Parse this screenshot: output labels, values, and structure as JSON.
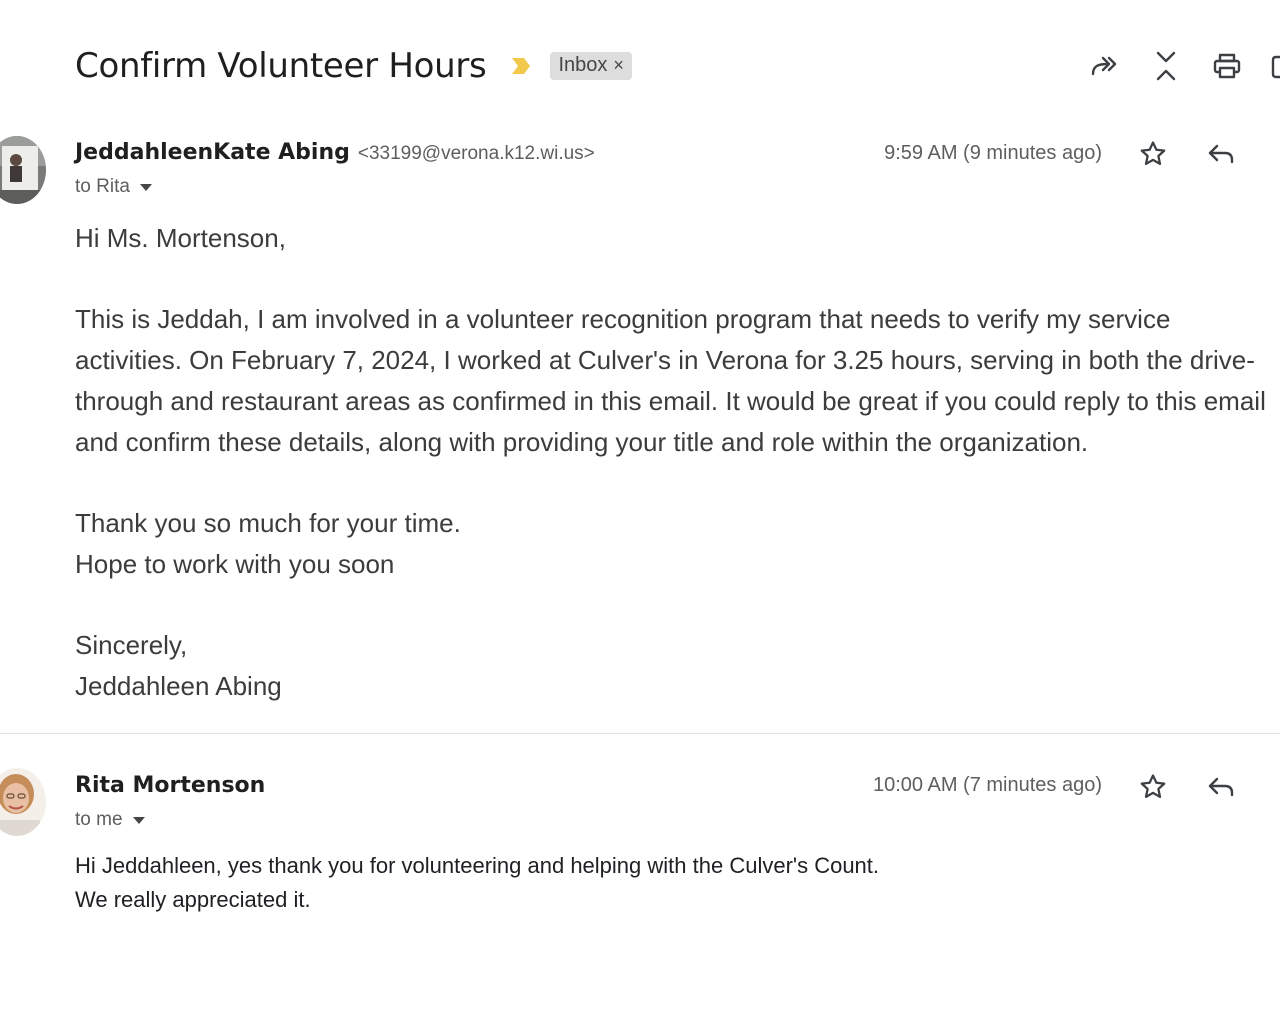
{
  "thread": {
    "subject": "Confirm Volunteer Hours",
    "label": "Inbox",
    "label_remove": "×"
  },
  "icons": {
    "important": "importance-marker-icon",
    "forward_all": "forward-all-icon",
    "collapse": "collapse-all-icon",
    "print": "print-icon",
    "new_window": "open-new-window-icon",
    "star": "star-icon",
    "reply": "reply-icon"
  },
  "colors": {
    "important_marker": "#f2c94c",
    "label_chip_bg": "#dddddd",
    "muted_text": "#5e5e5e"
  },
  "messages": [
    {
      "sender_name": "JeddahleenKate Abing",
      "sender_email": "<33199@verona.k12.wi.us>",
      "recipient": "to Rita",
      "time": "9:59 AM (9 minutes ago)",
      "paragraphs": [
        [
          "Hi Ms. Mortenson,"
        ],
        [
          "This is Jeddah, I am involved in a volunteer recognition program that needs to verify my service activities. On February 7, 2024, I worked at Culver's in Verona for 3.25 hours, serving in both the drive-through and restaurant areas as confirmed in this email. It would be great if you could reply to this email and confirm these details, along with providing your title and role within the organization."
        ],
        [
          "Thank you so much for your time.",
          "Hope to work with you soon"
        ],
        [
          "Sincerely,",
          "Jeddahleen Abing"
        ]
      ]
    },
    {
      "sender_name": "Rita Mortenson",
      "recipient": "to me",
      "time": "10:00 AM (7 minutes ago)",
      "lines": [
        "Hi Jeddahleen, yes thank you for volunteering and helping with the Culver's Count.",
        "We really appreciated it."
      ]
    }
  ]
}
